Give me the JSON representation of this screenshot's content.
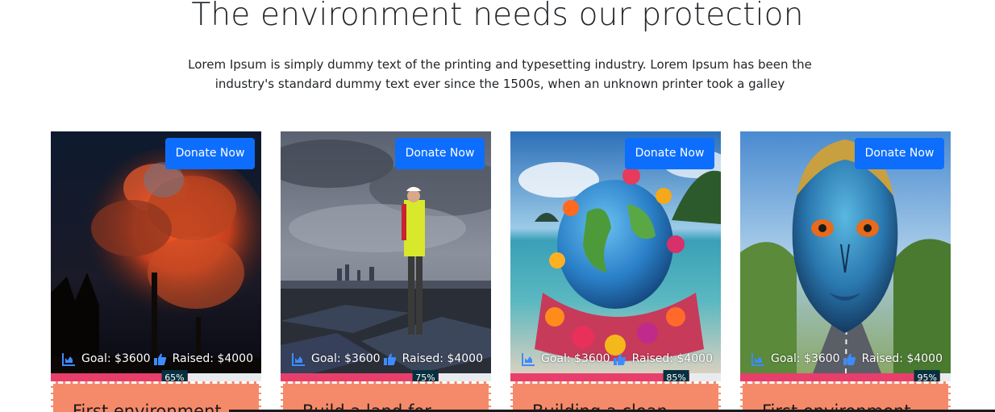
{
  "section": {
    "title": "The environment needs our protection",
    "description": "Lorem Ipsum is simply dummy text of the printing and typesetting industry. Lorem Ipsum has been the industry's standard dummy text ever since the 1500s, when an unknown printer took a galley"
  },
  "cards": [
    {
      "donate_label": "Donate Now",
      "goal": "Goal: $3600",
      "raised": "Raised: $4000",
      "progress": 65,
      "progress_label": "65%",
      "title": "First environment"
    },
    {
      "donate_label": "Donate Now",
      "goal": "Goal: $3600",
      "raised": "Raised: $4000",
      "progress": 75,
      "progress_label": "75%",
      "title": "Build a land for"
    },
    {
      "donate_label": "Donate Now",
      "goal": "Goal: $3600",
      "raised": "Raised: $4000",
      "progress": 85,
      "progress_label": "85%",
      "title": "Building a clean"
    },
    {
      "donate_label": "Donate Now",
      "goal": "Goal: $3600",
      "raised": "Raised: $4000",
      "progress": 95,
      "progress_label": "95%",
      "title": "First environment"
    }
  ],
  "colors": {
    "button": "#0d6efd",
    "progress_fill": "#e83e6c",
    "progress_label_bg": "#06303f",
    "card_body": "#f58a6a"
  },
  "icons": {
    "goal": "chart-area-icon",
    "raised": "thumbs-up-icon"
  }
}
